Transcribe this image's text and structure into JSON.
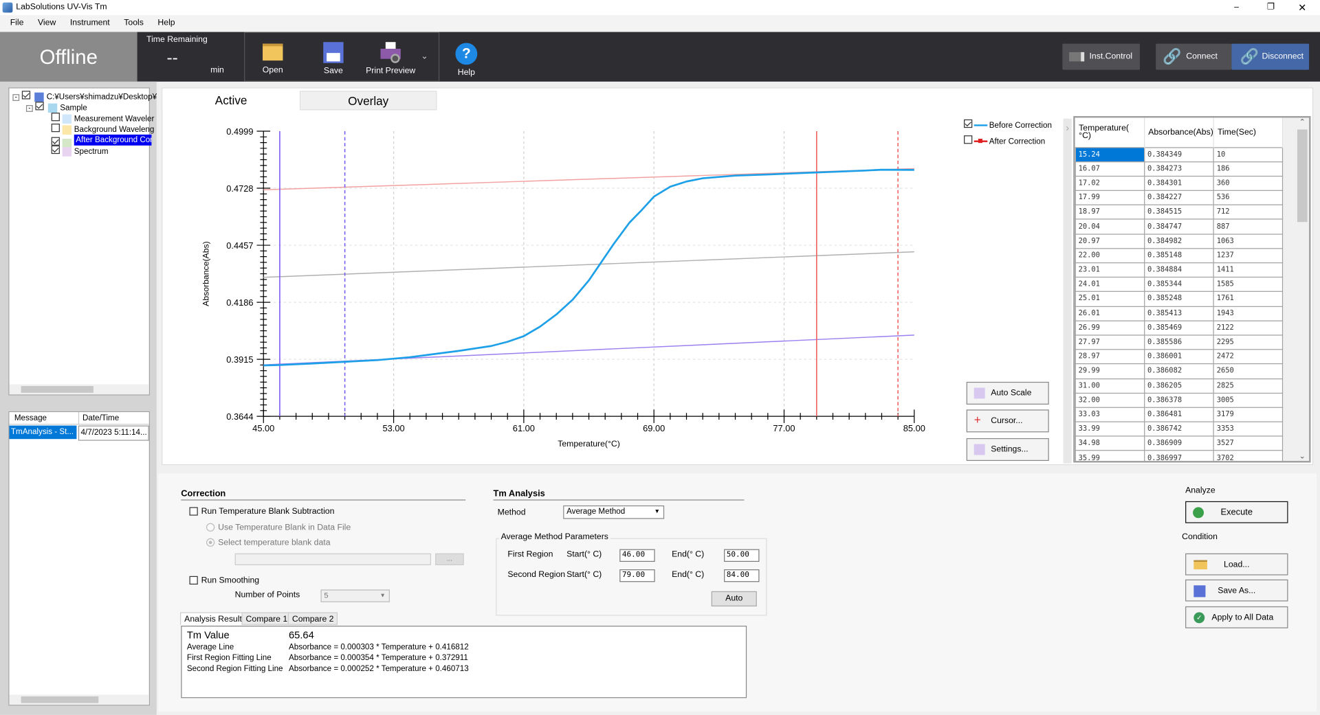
{
  "window": {
    "title": "LabSolutions UV-Vis Tm"
  },
  "menu": [
    "File",
    "View",
    "Instrument",
    "Tools",
    "Help"
  ],
  "toolbar": {
    "status": "Offline",
    "time_remaining_label": "Time Remaining",
    "time_remaining_value": "--",
    "time_unit": "min",
    "open": "Open",
    "save": "Save",
    "print_preview": "Print Preview",
    "help": "Help",
    "inst_control": "Inst.Control",
    "connect": "Connect",
    "disconnect": "Disconnect"
  },
  "tree": {
    "root": "C:¥Users¥shimadzu¥Desktop¥",
    "sample": "Sample",
    "items": [
      {
        "label": "Measurement Waveler",
        "checked": false,
        "icon": "measurement-curve-icon"
      },
      {
        "label": "Background Waveleng",
        "checked": false,
        "icon": "background-line-icon"
      },
      {
        "label": "After Background Cor",
        "checked": true,
        "icon": "corrected-curve-icon",
        "selected": true
      },
      {
        "label": "Spectrum",
        "checked": true,
        "icon": "spectrum-icon"
      }
    ]
  },
  "messages": {
    "headers": [
      "Message",
      "Date/Time"
    ],
    "rows": [
      [
        "TmAnalysis - St...",
        "4/7/2023 5:11:14..."
      ]
    ]
  },
  "tabs": [
    "Active",
    "Overlay"
  ],
  "legend": [
    {
      "label": "Before Correction",
      "checked": true,
      "color": "#1ea0e8"
    },
    {
      "label": "After Correction",
      "checked": false,
      "color": "#e02020"
    }
  ],
  "side_buttons": {
    "auto_scale": "Auto Scale",
    "cursor": "Cursor...",
    "settings": "Settings..."
  },
  "chart_data": {
    "type": "line",
    "xlabel": "Temperature(°C)",
    "ylabel": "Absorbance(Abs)",
    "xlim": [
      45,
      85
    ],
    "ylim": [
      0.3644,
      0.4999
    ],
    "xticks": [
      "45.00",
      "53.00",
      "61.00",
      "69.00",
      "77.00",
      "85.00"
    ],
    "yticks": [
      "0.4999",
      "0.4728",
      "0.4457",
      "0.4186",
      "0.3915",
      "0.3644"
    ],
    "grid": true,
    "series": [
      {
        "name": "Before Correction",
        "color": "#1ea0e8",
        "x": [
          45,
          46,
          48,
          50,
          52,
          54,
          55,
          57,
          59,
          60,
          61,
          62,
          63,
          64,
          65,
          65.6,
          66.5,
          67.5,
          68.2,
          69,
          70,
          71,
          72,
          74,
          76,
          78,
          80,
          82,
          83,
          85
        ],
        "y": [
          0.3886,
          0.3888,
          0.3895,
          0.3903,
          0.3911,
          0.3925,
          0.3935,
          0.3955,
          0.3978,
          0.3998,
          0.4025,
          0.407,
          0.4128,
          0.4198,
          0.429,
          0.4358,
          0.446,
          0.4565,
          0.462,
          0.4688,
          0.4735,
          0.476,
          0.4775,
          0.4788,
          0.4793,
          0.48,
          0.4806,
          0.4812,
          0.4816,
          0.4815
        ]
      }
    ],
    "fit_lines": [
      {
        "name": "Average Line",
        "color": "#b0b0b0",
        "slope": 0.000303,
        "intercept": 0.416812
      },
      {
        "name": "First Region Fitting Line",
        "color": "#9a7ff0",
        "slope": 0.000354,
        "intercept": 0.372911
      },
      {
        "name": "Second Region Fitting Line",
        "color": "#f3a0a0",
        "slope": 0.000252,
        "intercept": 0.460713
      }
    ],
    "markers": [
      {
        "x": 46,
        "color": "#7b5cf0",
        "style": "solid"
      },
      {
        "x": 50,
        "color": "#7b5cf0",
        "style": "dashed"
      },
      {
        "x": 79,
        "color": "#f06060",
        "style": "solid"
      },
      {
        "x": 84,
        "color": "#f06060",
        "style": "dashed"
      }
    ]
  },
  "data_table": {
    "headers": [
      "Temperature(\n°C)",
      "Absorbance(Abs)",
      "Time(Sec)"
    ],
    "rows": [
      [
        "15.24",
        "0.384349",
        "10"
      ],
      [
        "16.07",
        "0.384273",
        "186"
      ],
      [
        "17.02",
        "0.384301",
        "360"
      ],
      [
        "17.99",
        "0.384227",
        "536"
      ],
      [
        "18.97",
        "0.384515",
        "712"
      ],
      [
        "20.04",
        "0.384747",
        "887"
      ],
      [
        "20.97",
        "0.384982",
        "1063"
      ],
      [
        "22.00",
        "0.385148",
        "1237"
      ],
      [
        "23.01",
        "0.384884",
        "1411"
      ],
      [
        "24.01",
        "0.385344",
        "1585"
      ],
      [
        "25.01",
        "0.385248",
        "1761"
      ],
      [
        "26.01",
        "0.385413",
        "1943"
      ],
      [
        "26.99",
        "0.385469",
        "2122"
      ],
      [
        "27.97",
        "0.385586",
        "2295"
      ],
      [
        "28.97",
        "0.386001",
        "2472"
      ],
      [
        "29.99",
        "0.386082",
        "2650"
      ],
      [
        "31.00",
        "0.386205",
        "2825"
      ],
      [
        "32.00",
        "0.386378",
        "3005"
      ],
      [
        "33.03",
        "0.386481",
        "3179"
      ],
      [
        "33.99",
        "0.386742",
        "3353"
      ],
      [
        "34.98",
        "0.386909",
        "3527"
      ],
      [
        "35.99",
        "0.386997",
        "3702"
      ]
    ]
  },
  "correction": {
    "title": "Correction",
    "run_blank": "Run Temperature Blank Subtraction",
    "use_blank": "Use Temperature Blank in Data File",
    "select_blank": "Select temperature blank data",
    "browse": "...",
    "run_smoothing": "Run Smoothing",
    "num_points_label": "Number of Points",
    "num_points": "5"
  },
  "tm_analysis": {
    "title": "Tm Analysis",
    "method_label": "Method",
    "method": "Average Method",
    "params_title": "Average Method Parameters",
    "first_region": "First Region",
    "second_region": "Second Region",
    "start_label": "Start(° C)",
    "end_label": "End(° C)",
    "first_start": "46.00",
    "first_end": "50.00",
    "second_start": "79.00",
    "second_end": "84.00",
    "auto": "Auto"
  },
  "result_tabs": [
    "Analysis Result",
    "Compare 1",
    "Compare 2"
  ],
  "results": [
    [
      "Tm Value",
      "65.64"
    ],
    [
      "Average Line",
      "Absorbance = 0.000303 * Temperature + 0.416812"
    ],
    [
      "First Region Fitting Line",
      "Absorbance = 0.000354 * Temperature + 0.372911"
    ],
    [
      "Second Region Fitting Line",
      "Absorbance = 0.000252 * Temperature + 0.460713"
    ]
  ],
  "analyze": {
    "title": "Analyze",
    "execute": "Execute",
    "condition_title": "Condition",
    "load": "Load...",
    "save_as": "Save As...",
    "apply_all": "Apply to All Data"
  }
}
